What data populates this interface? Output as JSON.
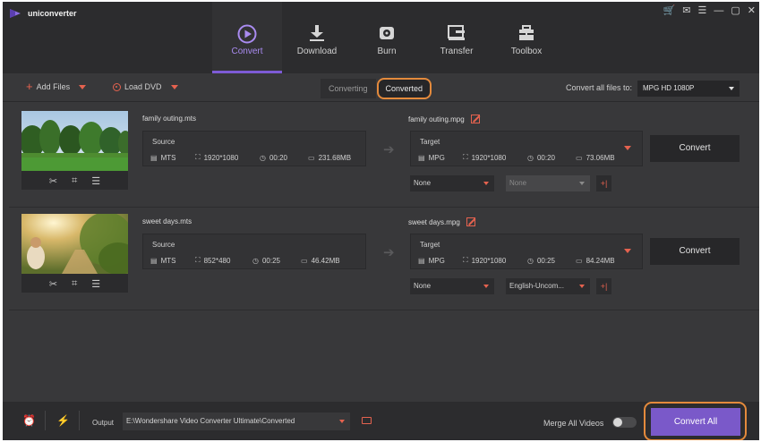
{
  "app": {
    "title": "uniconverter",
    "brand_color": "#7a59c9",
    "accent_color": "#e5624f",
    "highlight_color": "#e48a3c",
    "window_controls": [
      "cart-icon",
      "mail-icon",
      "menu-icon",
      "minimize-icon",
      "maximize-icon",
      "close-icon"
    ]
  },
  "nav": [
    {
      "label": "Convert",
      "icon": "play-circle-icon",
      "active": true
    },
    {
      "label": "Download",
      "icon": "download-icon",
      "active": false
    },
    {
      "label": "Burn",
      "icon": "disc-icon",
      "active": false
    },
    {
      "label": "Transfer",
      "icon": "transfer-icon",
      "active": false
    },
    {
      "label": "Toolbox",
      "icon": "toolbox-icon",
      "active": false
    }
  ],
  "toolbar": {
    "add_files": "Add Files",
    "load_dvd": "Load DVD",
    "tab_converting": "Converting",
    "tab_converted": "Converted",
    "convert_all_to_label": "Convert all files to:",
    "convert_all_to_value": "MPG HD 1080P"
  },
  "files": [
    {
      "source_name": "family outing.mts",
      "source_label": "Source",
      "source_format": "MTS",
      "source_resolution": "1920*1080",
      "source_duration": "00:20",
      "source_size": "231.68MB",
      "target_name": "family outing.mpg",
      "target_label": "Target",
      "target_format": "MPG",
      "target_resolution": "1920*1080",
      "target_duration": "00:20",
      "target_size": "73.06MB",
      "subtitle_select": "None",
      "audio_select": "None",
      "convert_label": "Convert",
      "thumb_tools": [
        "scissors-icon",
        "crop-icon",
        "adjust-icon"
      ]
    },
    {
      "source_name": "sweet days.mts",
      "source_label": "Source",
      "source_format": "MTS",
      "source_resolution": "852*480",
      "source_duration": "00:25",
      "source_size": "46.42MB",
      "target_name": "sweet days.mpg",
      "target_label": "Target",
      "target_format": "MPG",
      "target_resolution": "1920*1080",
      "target_duration": "00:25",
      "target_size": "84.24MB",
      "subtitle_select": "None",
      "audio_select": "English-Uncom...",
      "convert_label": "Convert",
      "thumb_tools": [
        "scissors-icon",
        "crop-icon",
        "adjust-icon"
      ]
    }
  ],
  "bottom": {
    "output_label": "Output",
    "output_path": "E:\\Wondershare Video Converter Ultimate\\Converted",
    "merge_label": "Merge All Videos",
    "merge_on": false,
    "convert_all": "Convert All"
  }
}
